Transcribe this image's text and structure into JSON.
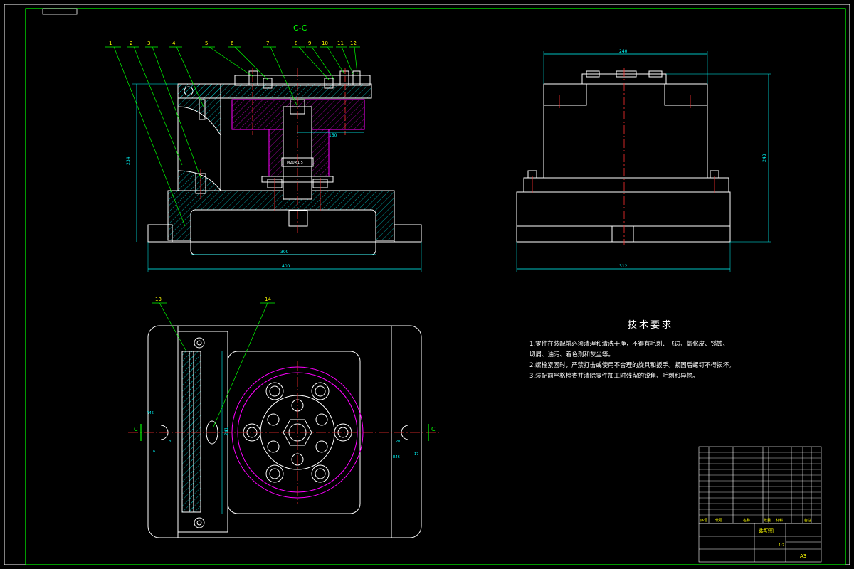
{
  "section_label": "C-C",
  "section_marks": [
    "C",
    "C"
  ],
  "part_labels": [
    "1",
    "2",
    "3",
    "4",
    "5",
    "6",
    "7",
    "8",
    "9",
    "10",
    "11",
    "12"
  ],
  "plan_labels": [
    "13",
    "14"
  ],
  "dimensions": {
    "front_height": "234",
    "front_inner": "150",
    "front_base_inner": "300",
    "front_overall": "400",
    "side_top": "240",
    "side_height": "248",
    "side_overall": "312",
    "plan_width": "241",
    "plan_r_left": "R46",
    "plan_r_right": "R46",
    "plan_d_left": "20",
    "plan_d_right": "20",
    "plan_g_left": "16",
    "plan_g_right": "17",
    "spindle_note": "M20×1.5"
  },
  "tech_requirements": {
    "title": "技术要求",
    "lines": [
      "1.零件在装配前必须清理和清洗干净，不得有毛刺、飞边、氧化皮、锈蚀、",
      "切屑、油污、着色剂和灰尘等。",
      "2.螺栓紧固时，严禁打击或使用不合理的旋具和扳手。紧固后螺钉不得损坏。",
      "3.装配前严格检查并清除零件加工时残留的锐角、毛刺和异物。"
    ]
  },
  "title_block": {
    "drawing_name": "装配图",
    "scale": "1:2",
    "sheet": "A3",
    "header": [
      "序号",
      "代号",
      "名称",
      "数量",
      "材料",
      "备注"
    ]
  },
  "colors": {
    "background": "#000000",
    "outline": "#ffffff",
    "border": "#00ff00",
    "dimension": "#00ffff",
    "leader": "#00ff00",
    "centerline": "#ff3030",
    "hatch": "#00ffff",
    "magenta": "#ff00ff",
    "label": "#ffff00"
  }
}
